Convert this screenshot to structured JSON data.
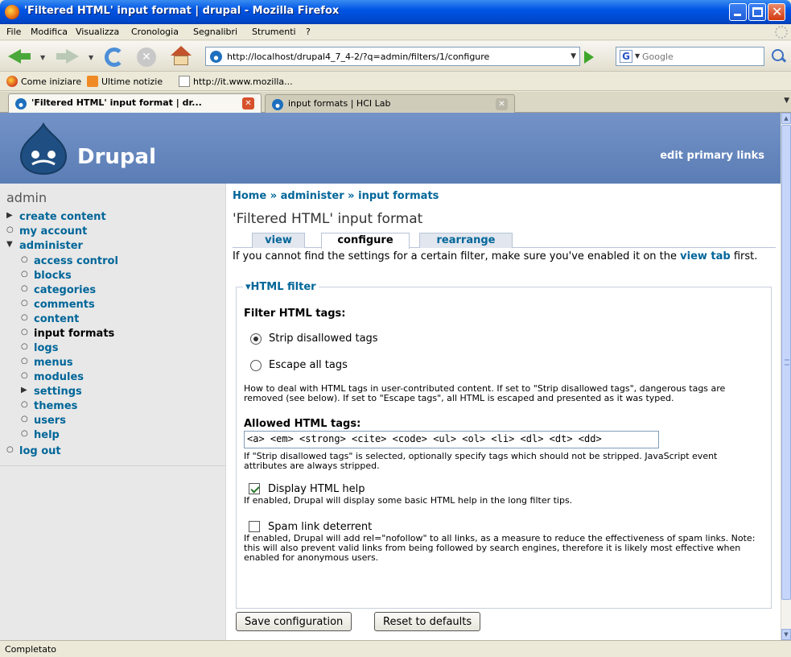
{
  "window": {
    "title": "'Filtered HTML' input format  |  drupal - Mozilla Firefox"
  },
  "menu": [
    "File",
    "Modifica",
    "Visualizza",
    "Cronologia",
    "Segnalibri",
    "Strumenti",
    "?"
  ],
  "navbar": {
    "url": "http://localhost/drupal4_7_4-2/?q=admin/filters/1/configure",
    "search_placeholder": "Google"
  },
  "bookmarks": [
    "Come iniziare",
    "Ultime notizie",
    "http://it.www.mozilla..."
  ],
  "tabs": [
    {
      "label": "'Filtered HTML' input format | dr..."
    },
    {
      "label": "input formats | HCI Lab"
    }
  ],
  "site": {
    "name": "Drupal",
    "primary_link": "edit primary links"
  },
  "sidebar": {
    "user": "admin",
    "items": [
      {
        "label": "create content"
      },
      {
        "label": "my account"
      },
      {
        "label": "administer"
      },
      {
        "label": "access control"
      },
      {
        "label": "blocks"
      },
      {
        "label": "categories"
      },
      {
        "label": "comments"
      },
      {
        "label": "content"
      },
      {
        "label": "input formats"
      },
      {
        "label": "logs"
      },
      {
        "label": "menus"
      },
      {
        "label": "modules"
      },
      {
        "label": "settings"
      },
      {
        "label": "themes"
      },
      {
        "label": "users"
      },
      {
        "label": "help"
      },
      {
        "label": "log out"
      }
    ]
  },
  "main": {
    "breadcrumb": [
      "Home",
      "administer",
      "input formats"
    ],
    "breadcrumb_sep": "»",
    "title": "'Filtered HTML' input format",
    "tabs": [
      "view",
      "configure",
      "rearrange"
    ],
    "intro_before": "If you cannot find the settings for a certain filter, make sure you've enabled it on the ",
    "intro_link": "view tab",
    "intro_after": " first.",
    "fieldset_legend": "HTML filter",
    "filter_tags_label": "Filter HTML tags:",
    "radio_strip": "Strip disallowed tags",
    "radio_escape": "Escape all tags",
    "filter_desc": "How to deal with HTML tags in user-contributed content. If set to \"Strip disallowed tags\", dangerous tags are removed (see below). If set to \"Escape tags\", all HTML is escaped and presented as it was typed.",
    "allowed_label": "Allowed HTML tags:",
    "allowed_value": "<a> <em> <strong> <cite> <code> <ul> <ol> <li> <dl> <dt> <dd>",
    "allowed_desc": "If \"Strip disallowed tags\" is selected, optionally specify tags which should not be stripped. JavaScript event attributes are always stripped.",
    "help_label": "Display HTML help",
    "help_desc": "If enabled, Drupal will display some basic HTML help in the long filter tips.",
    "spam_label": "Spam link deterrent",
    "spam_desc": "If enabled, Drupal will add rel=\"nofollow\" to all links, as a measure to reduce the effectiveness of spam links. Note: this will also prevent valid links from being followed by search engines, therefore it is likely most effective when enabled for anonymous users.",
    "save_button": "Save configuration",
    "reset_button": "Reset to defaults"
  },
  "status": "Completato"
}
